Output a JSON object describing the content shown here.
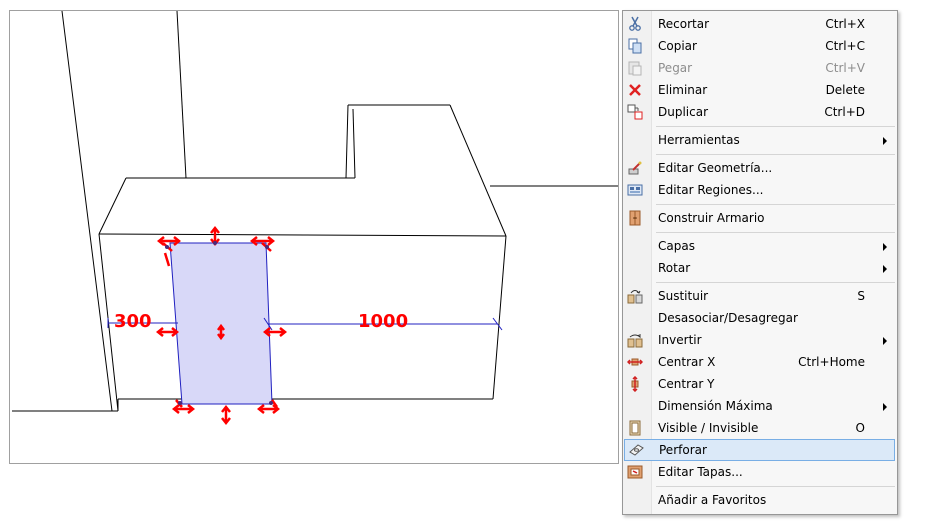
{
  "viewport": {
    "dimensions": [
      {
        "label": "300"
      },
      {
        "label": "1000"
      }
    ]
  },
  "context_menu": {
    "items": [
      {
        "label": "Recortar",
        "shortcut": "Ctrl+X",
        "icon": "scissors-icon",
        "enabled": true
      },
      {
        "label": "Copiar",
        "shortcut": "Ctrl+C",
        "icon": "copy-icon",
        "enabled": true
      },
      {
        "label": "Pegar",
        "shortcut": "Ctrl+V",
        "icon": "paste-icon",
        "enabled": false
      },
      {
        "label": "Eliminar",
        "shortcut": "Delete",
        "icon": "delete-x-icon",
        "enabled": true
      },
      {
        "label": "Duplicar",
        "shortcut": "Ctrl+D",
        "icon": "duplicate-icon",
        "enabled": true
      },
      {
        "label": "Herramientas",
        "shortcut": "",
        "submenu": true,
        "enabled": true
      },
      {
        "label": "Editar Geometría...",
        "shortcut": "",
        "icon": "edit-geometry-icon",
        "enabled": true
      },
      {
        "label": "Editar Regiones...",
        "shortcut": "",
        "icon": "edit-regions-icon",
        "enabled": true
      },
      {
        "label": "Construir Armario",
        "shortcut": "",
        "icon": "cabinet-icon",
        "enabled": true
      },
      {
        "label": "Capas",
        "shortcut": "",
        "submenu": true,
        "enabled": true
      },
      {
        "label": "Rotar",
        "shortcut": "",
        "submenu": true,
        "enabled": true
      },
      {
        "label": "Sustituir",
        "shortcut": "S",
        "icon": "replace-icon",
        "enabled": true
      },
      {
        "label": "Desasociar/Desagregar",
        "shortcut": "",
        "enabled": true
      },
      {
        "label": "Invertir",
        "shortcut": "",
        "icon": "invert-icon",
        "submenu": true,
        "enabled": true
      },
      {
        "label": "Centrar X",
        "shortcut": "Ctrl+Home",
        "icon": "center-x-icon",
        "enabled": true
      },
      {
        "label": "Centrar Y",
        "shortcut": "",
        "icon": "center-y-icon",
        "enabled": true
      },
      {
        "label": "Dimensión Máxima",
        "shortcut": "",
        "submenu": true,
        "enabled": true
      },
      {
        "label": "Visible / Invisible",
        "shortcut": "O",
        "icon": "visibility-icon",
        "enabled": true
      },
      {
        "label": "Perforar",
        "shortcut": "",
        "icon": "perforate-icon",
        "enabled": true,
        "highlighted": true
      },
      {
        "label": "Editar Tapas...",
        "shortcut": "",
        "icon": "edit-covers-icon",
        "enabled": true
      },
      {
        "label": "Añadir a Favoritos",
        "shortcut": "",
        "enabled": true
      }
    ]
  },
  "colors": {
    "dimension_text": "#ff0000",
    "dimension_line": "#2020c0",
    "selection_fill": "#d8d8f8",
    "highlight_bg": "#dbe9f8",
    "highlight_border": "#78aee5"
  }
}
